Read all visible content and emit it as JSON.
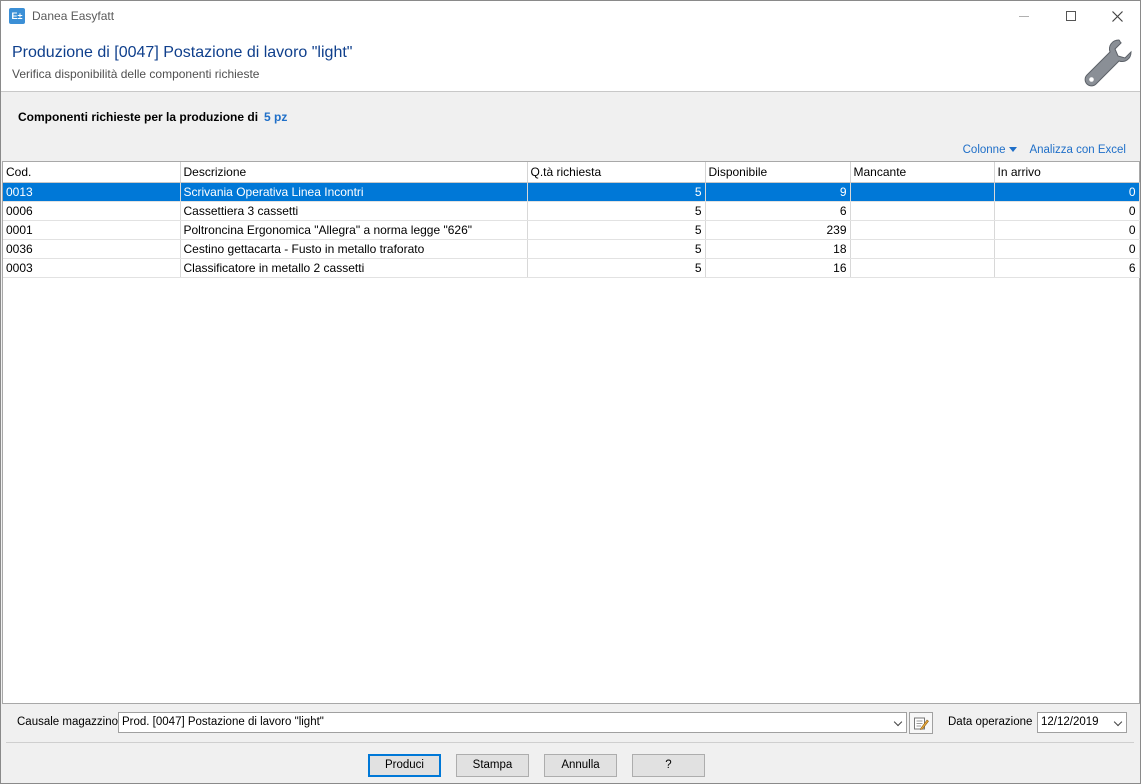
{
  "window": {
    "title": "Danea Easyfatt",
    "app_icon_text": "E±"
  },
  "header": {
    "title": "Produzione di  [0047] Postazione di lavoro \"light\"",
    "subtitle": "Verifica disponibilità delle componenti richieste"
  },
  "summary": {
    "label": "Componenti richieste per la produzione di",
    "quantity": "5 pz"
  },
  "links": {
    "columns": "Colonne",
    "excel": "Analizza con Excel"
  },
  "table": {
    "columns": [
      "Cod.",
      "Descrizione",
      "Q.tà richiesta",
      "Disponibile",
      "Mancante",
      "In arrivo"
    ],
    "rows": [
      {
        "cod": "0013",
        "descr": "Scrivania Operativa Linea Incontri",
        "qta": "5",
        "disp": "9",
        "manc": "",
        "arrivo": "0",
        "selected": true
      },
      {
        "cod": "0006",
        "descr": "Cassettiera 3 cassetti",
        "qta": "5",
        "disp": "6",
        "manc": "",
        "arrivo": "0",
        "selected": false
      },
      {
        "cod": "0001",
        "descr": "Poltroncina Ergonomica \"Allegra\" a norma legge \"626\"",
        "qta": "5",
        "disp": "239",
        "manc": "",
        "arrivo": "0",
        "selected": false
      },
      {
        "cod": "0036",
        "descr": "Cestino gettacarta - Fusto in metallo traforato",
        "qta": "5",
        "disp": "18",
        "manc": "",
        "arrivo": "0",
        "selected": false
      },
      {
        "cod": "0003",
        "descr": "Classificatore in metallo 2 cassetti",
        "qta": "5",
        "disp": "16",
        "manc": "",
        "arrivo": "6",
        "selected": false
      }
    ]
  },
  "footer": {
    "causale_label": "Causale magazzino",
    "causale_value": "Prod.  [0047] Postazione di lavoro \"light\"",
    "data_label": "Data operazione",
    "data_value": "12/12/2019",
    "buttons": {
      "produci": "Produci",
      "stampa": "Stampa",
      "annulla": "Annulla",
      "help": "?"
    }
  },
  "colors": {
    "accent": "#0078d7",
    "title_blue": "#0f3f8c",
    "link_blue": "#1f6fc8"
  }
}
